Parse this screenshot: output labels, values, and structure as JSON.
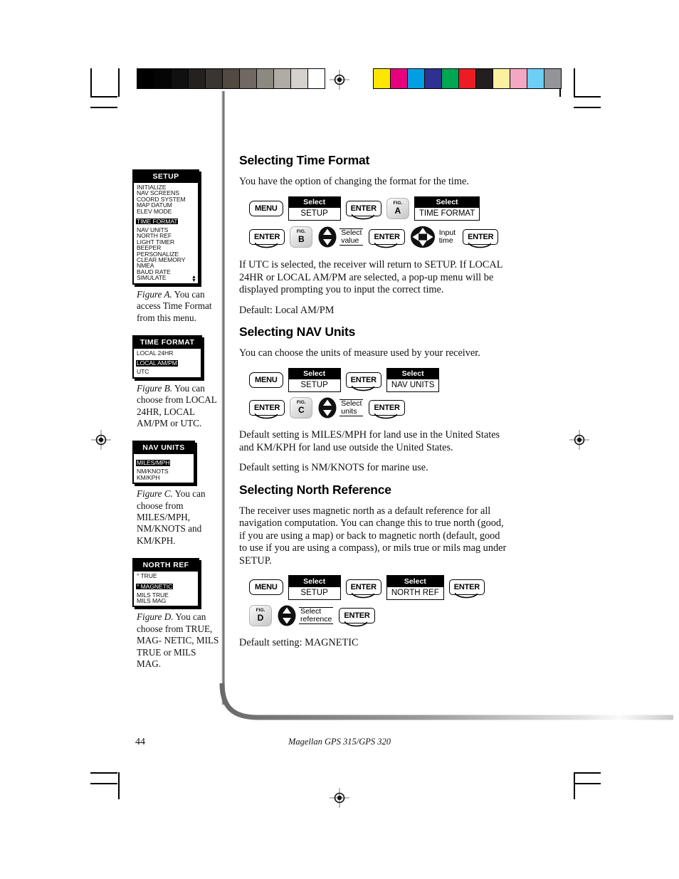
{
  "print_marks": {
    "gray_wedge": [
      "#000000",
      "#050505",
      "#101010",
      "#24211f",
      "#3a352f",
      "#514a42",
      "#6f6961",
      "#8d8880",
      "#b0aba3",
      "#d5d2cc",
      "#ffffff"
    ],
    "color_bar": [
      "#ffe600",
      "#e6007e",
      "#009fe3",
      "#2e3192",
      "#00a651",
      "#ed1c24",
      "#231f20",
      "#faf0a0",
      "#f4a7c3",
      "#6dcff6",
      "#939598"
    ]
  },
  "footer": {
    "page_number": "44",
    "book_name": "Magellan GPS 315/GPS 320"
  },
  "sidebar": {
    "figures": [
      {
        "lcd_title": "SETUP",
        "rows": [
          {
            "label": "INITIALIZE",
            "highlighted": false
          },
          {
            "label": "NAV SCREENS",
            "highlighted": false
          },
          {
            "label": "COORD SYSTEM",
            "highlighted": false
          },
          {
            "label": "MAP DATUM",
            "highlighted": false
          },
          {
            "label": "ELEV MODE",
            "highlighted": false
          },
          {
            "label": "TIME FORMAT",
            "highlighted": true
          },
          {
            "label": "NAV UNITS",
            "highlighted": false
          },
          {
            "label": "NORTH REF",
            "highlighted": false
          },
          {
            "label": "LIGHT TIMER",
            "highlighted": false
          },
          {
            "label": "BEEPER",
            "highlighted": false
          },
          {
            "label": "PERSONALIZE",
            "highlighted": false
          },
          {
            "label": "CLEAR MEMORY",
            "highlighted": false
          },
          {
            "label": "NMEA",
            "highlighted": false
          },
          {
            "label": "BAUD RATE",
            "highlighted": false
          },
          {
            "label": "SIMULATE",
            "highlighted": false
          }
        ],
        "scroll_up": "▲",
        "scroll_down": "▼",
        "caption_label": "Figure A.",
        "caption_text": "You can access Time Format from this menu."
      },
      {
        "lcd_title": "TIME FORMAT",
        "rows": [
          {
            "label": "LOCAL 24HR",
            "highlighted": false
          },
          {
            "label": "LOCAL AM/PM",
            "highlighted": true
          },
          {
            "label": "UTC",
            "highlighted": false
          }
        ],
        "caption_label": "Figure B.",
        "caption_text": "You can choose from LOCAL 24HR, LOCAL AM/PM or UTC."
      },
      {
        "lcd_title": "NAV UNITS",
        "rows": [
          {
            "label": "MILES/MPH",
            "highlighted": true
          },
          {
            "label": "NM/KNOTS",
            "highlighted": false
          },
          {
            "label": "KM/KPH",
            "highlighted": false
          }
        ],
        "caption_label": "Figure C.",
        "caption_text": "You can choose from MILES/MPH, NM/KNOTS and KM/KPH."
      },
      {
        "lcd_title": "NORTH REF",
        "rows": [
          {
            "label": "° TRUE",
            "highlighted": false
          },
          {
            "label": "° MAGNETIC",
            "highlighted": true
          },
          {
            "label": "MILS TRUE",
            "highlighted": false
          },
          {
            "label": "MILS MAG",
            "highlighted": false
          }
        ],
        "caption_label": "Figure D.",
        "caption_text": "You can choose from TRUE,  MAG- NETIC, MILS TRUE or MILS MAG."
      }
    ]
  },
  "main": {
    "sections": [
      {
        "heading": "Selecting Time Format",
        "intro": "You have the option of changing the format for the time.",
        "seq_row1": [
          {
            "kind": "key",
            "label": "MENU"
          },
          {
            "kind": "display",
            "head": "Select",
            "value": "SETUP"
          },
          {
            "kind": "key",
            "label": "ENTER"
          },
          {
            "kind": "figbadge",
            "top": "FIG.",
            "letter": "A"
          },
          {
            "kind": "display",
            "head": "Select",
            "value": "TIME FORMAT"
          }
        ],
        "seq_row2": [
          {
            "kind": "key",
            "label": "ENTER"
          },
          {
            "kind": "figbadge",
            "top": "FIG.",
            "letter": "B"
          },
          {
            "kind": "updown",
            "label": "Select value"
          },
          {
            "kind": "key",
            "label": "ENTER"
          },
          {
            "kind": "fourway",
            "label": "Input time"
          },
          {
            "kind": "key",
            "label": "ENTER"
          }
        ],
        "after": [
          "If UTC is selected, the receiver will return to SETUP.  If LOCAL 24HR or LOCAL AM/PM are selected, a pop-up menu will be displayed prompting you to input the correct time.",
          "Default:  Local AM/PM"
        ]
      },
      {
        "heading": "Selecting NAV Units",
        "intro": "You can choose the units of measure used by your receiver.",
        "seq_row1": [
          {
            "kind": "key",
            "label": "MENU"
          },
          {
            "kind": "display",
            "head": "Select",
            "value": "SETUP"
          },
          {
            "kind": "key",
            "label": "ENTER"
          },
          {
            "kind": "display",
            "head": "Select",
            "value": "NAV UNITS"
          }
        ],
        "seq_row2": [
          {
            "kind": "key",
            "label": "ENTER"
          },
          {
            "kind": "figbadge",
            "top": "FIG.",
            "letter": "C"
          },
          {
            "kind": "updown",
            "label": "Select units"
          },
          {
            "kind": "key",
            "label": "ENTER"
          }
        ],
        "after": [
          "Default setting is MILES/MPH for land use in the United States and KM/KPH for land use outside the United States.",
          "Default setting is NM/KNOTS for marine use."
        ]
      },
      {
        "heading": "Selecting North Reference",
        "intro": "The receiver uses magnetic north as a default reference for all navigation computation.  You can change this to true north (good, if you are using a map) or back to magnetic north (default, good to use if you are using a compass), or mils true or mils mag under SETUP.",
        "seq_row1": [
          {
            "kind": "key",
            "label": "MENU"
          },
          {
            "kind": "display",
            "head": "Select",
            "value": "SETUP"
          },
          {
            "kind": "key",
            "label": "ENTER"
          },
          {
            "kind": "display",
            "head": "Select",
            "value": "NORTH REF"
          },
          {
            "kind": "key",
            "label": "ENTER"
          }
        ],
        "seq_row2": [
          {
            "kind": "figbadge",
            "top": "FIG.",
            "letter": "D"
          },
          {
            "kind": "updown",
            "label": "Select reference"
          },
          {
            "kind": "key",
            "label": "ENTER"
          }
        ],
        "after": [
          "Default setting:  MAGNETIC"
        ]
      }
    ]
  }
}
